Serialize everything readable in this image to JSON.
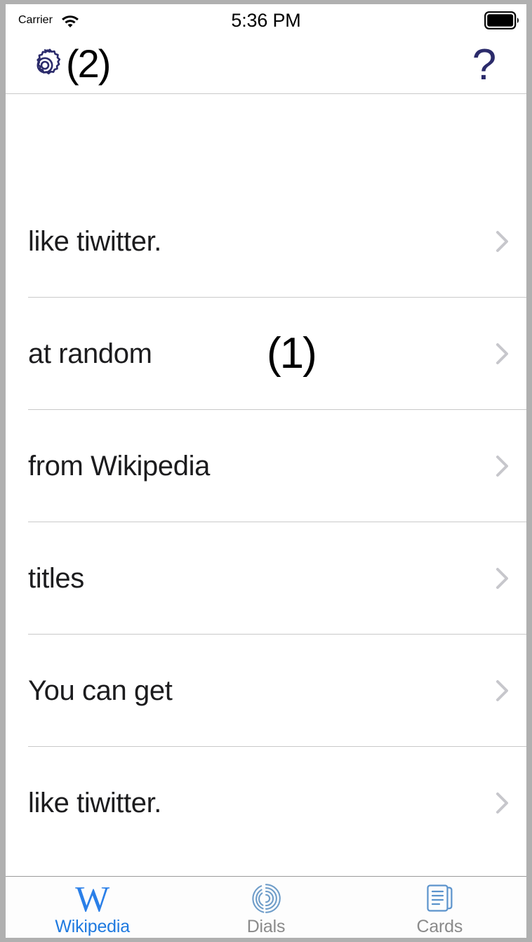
{
  "status_bar": {
    "carrier": "Carrier",
    "wifi_icon": "wifi-icon",
    "time": "5:36 PM",
    "battery_icon": "battery-full-icon"
  },
  "nav_bar": {
    "settings_icon": "gear-icon",
    "settings_count": "(2)",
    "help_icon": "question-mark-icon",
    "help_label": "?"
  },
  "list": {
    "rows": [
      {
        "label": "like tiwitter.",
        "annotation": "",
        "chevron": "chevron-right-icon"
      },
      {
        "label": "at random",
        "annotation": "(1)",
        "chevron": "chevron-right-icon"
      },
      {
        "label": "from Wikipedia",
        "annotation": "",
        "chevron": "chevron-right-icon"
      },
      {
        "label": "titles",
        "annotation": "",
        "chevron": "chevron-right-icon"
      },
      {
        "label": "You can get",
        "annotation": "",
        "chevron": "chevron-right-icon"
      },
      {
        "label": "like tiwitter.",
        "annotation": "",
        "chevron": "chevron-right-icon"
      }
    ]
  },
  "tab_bar": {
    "tabs": [
      {
        "label": "Wikipedia",
        "icon": "wikipedia-w-icon",
        "active": true
      },
      {
        "label": "Dials",
        "icon": "dials-spiral-icon",
        "active": false
      },
      {
        "label": "Cards",
        "icon": "cards-stack-icon",
        "active": false
      }
    ]
  },
  "colors": {
    "accent_blue": "#2a7fe8",
    "nav_icon_navy": "#2b2b6b",
    "inactive_gray": "#8a8a8a",
    "tab_icon_muted": "#6f9dc9",
    "chevron_gray": "#c7c7cc",
    "divider_gray": "#c9c9c9"
  }
}
